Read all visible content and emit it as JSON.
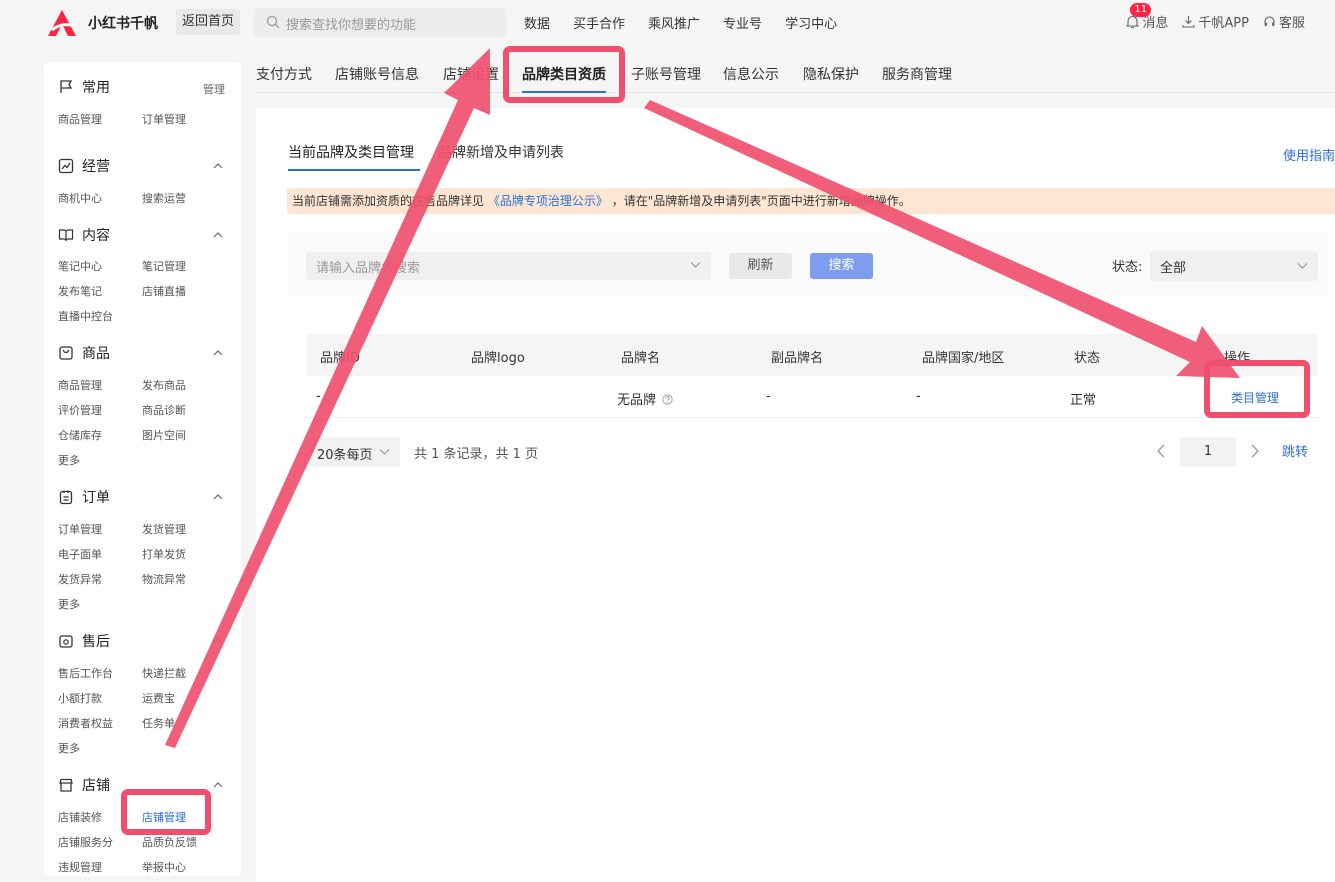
{
  "header": {
    "logo_text": "小红书千帆",
    "home_button": "返回首页",
    "search_placeholder": "搜索查找你想要的功能",
    "nav": [
      "数据",
      "买手合作",
      "乘风推广",
      "专业号",
      "学习中心"
    ],
    "message_label": "消息",
    "message_badge": "11",
    "app_label": "千帆APP",
    "service_label": "客服"
  },
  "sidebar": {
    "common": {
      "title": "常用",
      "manage": "管理",
      "items": [
        "商品管理",
        "订单管理"
      ]
    },
    "operation": {
      "title": "经营",
      "items": [
        "商机中心",
        "搜索运营"
      ]
    },
    "content": {
      "title": "内容",
      "items": [
        "笔记中心",
        "笔记管理",
        "发布笔记",
        "店铺直播",
        "直播中控台"
      ]
    },
    "goods": {
      "title": "商品",
      "items": [
        "商品管理",
        "发布商品",
        "评价管理",
        "商品诊断",
        "仓储库存",
        "图片空间",
        "更多"
      ]
    },
    "order": {
      "title": "订单",
      "items": [
        "订单管理",
        "发货管理",
        "电子面单",
        "打单发货",
        "发货异常",
        "物流异常",
        "更多"
      ]
    },
    "aftersale": {
      "title": "售后",
      "items": [
        "售后工作台",
        "快递拦截",
        "小额打款",
        "运费宝",
        "消费者权益",
        "任务单",
        "更多"
      ]
    },
    "shop": {
      "title": "店铺",
      "items": [
        "店铺装修",
        "店铺管理",
        "店铺服务分",
        "品质负反馈",
        "违规管理",
        "举报中心"
      ]
    }
  },
  "tabs": [
    "支付方式",
    "店铺账号信息",
    "店铺设置",
    "品牌类目资质",
    "子账号管理",
    "信息公示",
    "隐私保护",
    "服务商管理"
  ],
  "active_tab": "品牌类目资质",
  "subtabs": [
    "当前品牌及类目管理",
    "品牌新增及申请列表"
  ],
  "guide_link": "使用指南",
  "notice": {
    "prefix": "当前店铺需添加资质的在售品牌详见",
    "link": "《品牌专项治理公示》",
    "suffix": "，请在\"品牌新增及申请列表\"页面中进行新增品牌操作。"
  },
  "filter": {
    "brand_placeholder": "请输入品牌名搜索",
    "refresh": "刷新",
    "search": "搜索",
    "status_label": "状态:",
    "status_value": "全部"
  },
  "table": {
    "headers": [
      "品牌ID",
      "品牌logo",
      "品牌名",
      "副品牌名",
      "品牌国家/地区",
      "状态",
      "操作"
    ],
    "rows": [
      {
        "id": "-",
        "logo": "",
        "name": "无品牌",
        "sub_name": "-",
        "country": "-",
        "status": "正常",
        "action": "类目管理"
      }
    ]
  },
  "pagination": {
    "page_size": "20条每页",
    "total": "共 1 条记录，共 1 页",
    "current": "1",
    "jump": "跳转"
  },
  "colors": {
    "accent": "#2b6fd6",
    "annotation": "#f0506e",
    "brand": "#ff2442"
  }
}
